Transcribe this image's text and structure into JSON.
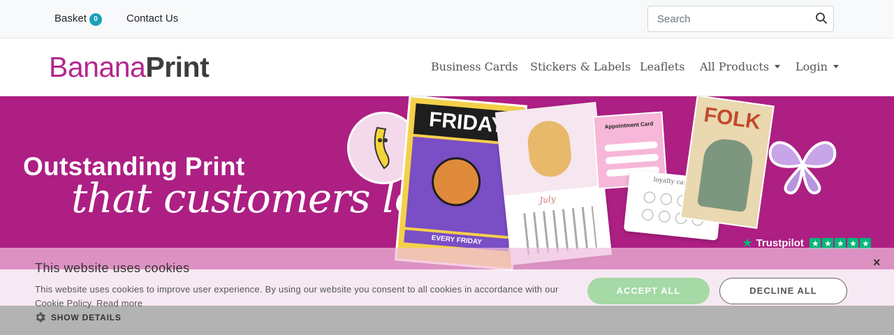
{
  "topbar": {
    "basket_label": "Basket",
    "basket_count": "0",
    "contact_label": "Contact Us",
    "search_placeholder": "Search",
    "search_icon": "search-icon"
  },
  "brand": {
    "logo_part1": "Banana",
    "logo_part2": "Print",
    "color_primary": "#ad1f83",
    "color_dark": "#3d3d3d"
  },
  "nav": {
    "items": [
      {
        "label": "Business Cards"
      },
      {
        "label": "Stickers & Labels"
      },
      {
        "label": "Leaflets"
      },
      {
        "label": "All Products"
      },
      {
        "label": "Login"
      }
    ]
  },
  "hero": {
    "headline": "Outstanding Print",
    "tagline": "that customers love",
    "background_color": "#ad1f83",
    "cards": {
      "poster_title": "FRIDAY",
      "poster_footer": "EVERY FRIDAY",
      "calendar_month": "July",
      "appointment_title": "Appointment Card",
      "loyalty_title": "loyalty card",
      "folk_title": "FOLK"
    },
    "trustpilot_label": "Trustpilot",
    "trustpilot_stars": 5
  },
  "cookie": {
    "title": "This website uses cookies",
    "text": "This website uses cookies to improve user experience. By using our website you consent to all cookies in accordance with our Cookie Policy.",
    "read_more": "Read more",
    "accept_label": "ACCEPT ALL",
    "decline_label": "DECLINE ALL",
    "show_details_label": "SHOW DETAILS",
    "close_symbol": "×",
    "accept_color": "#a5d9a5"
  }
}
